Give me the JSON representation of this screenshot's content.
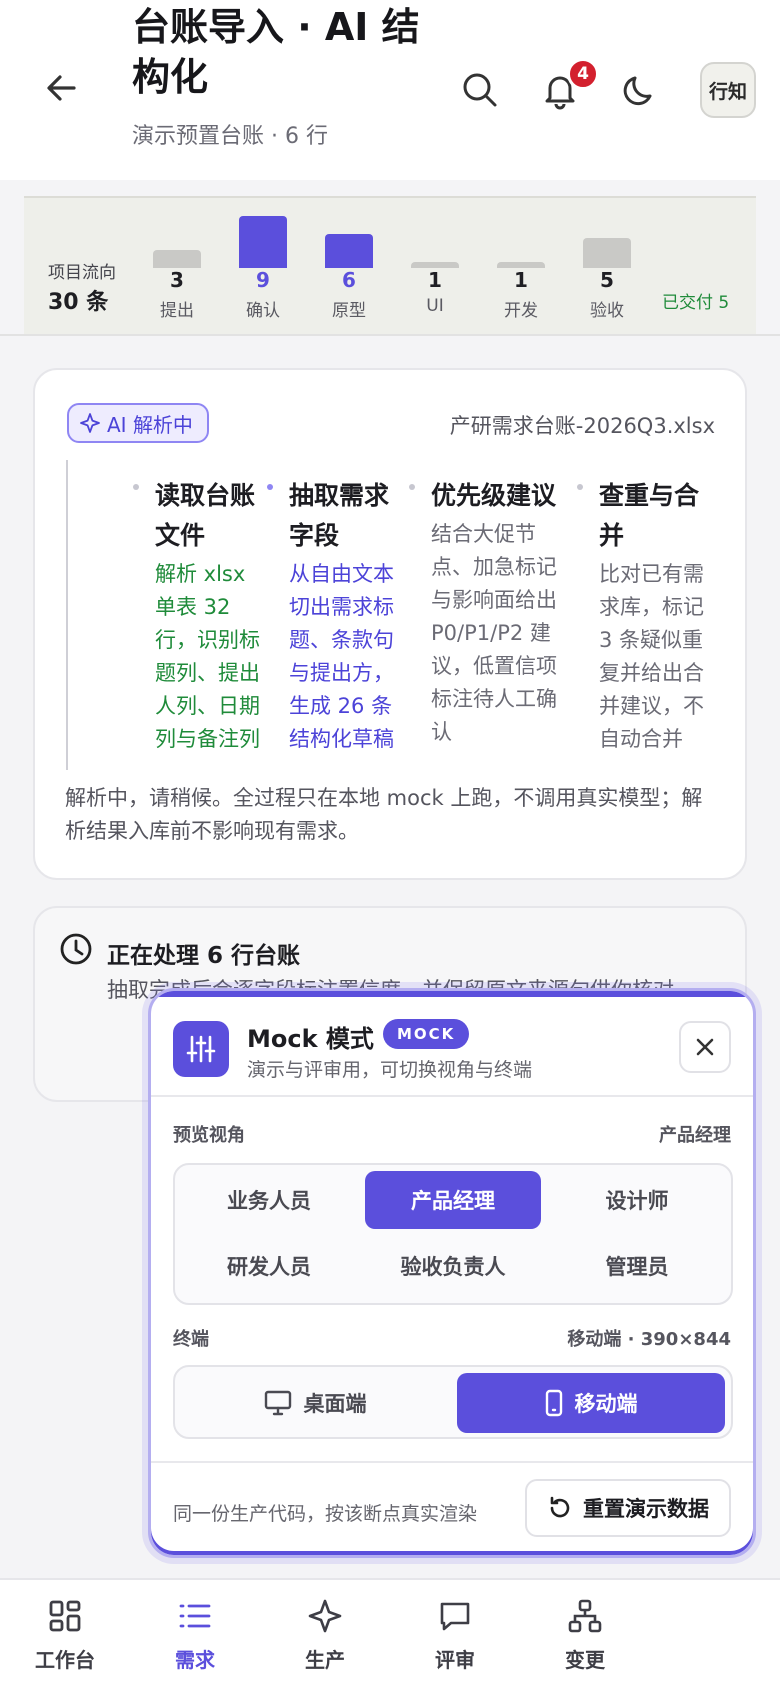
{
  "header": {
    "title": "台账导入 · AI 结构化",
    "subtitle": "演示预置台账 · 6 行",
    "notification_count": "4",
    "avatar_text": "行知",
    "icons": [
      "back-arrow-icon",
      "search-icon",
      "bell-icon",
      "moon-icon"
    ]
  },
  "flow": {
    "label": "项目流向",
    "count": "30 条",
    "stages": [
      {
        "label": "提出",
        "count": "3",
        "highlight": false
      },
      {
        "label": "确认",
        "count": "9",
        "highlight": true
      },
      {
        "label": "原型",
        "count": "6",
        "highlight": true
      },
      {
        "label": "UI",
        "count": "1",
        "highlight": false
      },
      {
        "label": "开发",
        "count": "1",
        "highlight": false
      },
      {
        "label": "验收",
        "count": "5",
        "highlight": false
      }
    ],
    "delivered": "已交付 5"
  },
  "parse_card": {
    "chip": "AI 解析中",
    "filename": "产研需求台账-2026Q3.xlsx",
    "steps": [
      {
        "title": "读取台账文件",
        "desc": "解析 xlsx 单表 32 行，识别标题列、提出人列、日期列与备注列",
        "state": "done"
      },
      {
        "title": "抽取需求字段",
        "desc": "从自由文本切出需求标题、条款句与提出方，生成 26 条结构化草稿",
        "state": "active"
      },
      {
        "title": "优先级建议",
        "desc": "结合大促节点、加急标记与影响面给出 P0/P1/P2 建议，低置信项标注待人工确认",
        "state": "pending"
      },
      {
        "title": "查重与合并",
        "desc": "比对已有需求库，标记 3 条疑似重复并给出合并建议，不自动合并",
        "state": "pending"
      }
    ],
    "note": "解析中，请稍候。全过程只在本地 mock 上跑，不调用真实模型；解析结果入库前不影响现有需求。"
  },
  "processing_card": {
    "title": "正在处理 6 行台账",
    "body": "抽取完成后会逐字段标注置信度，并保留原文来源句供你核对"
  },
  "mock_panel": {
    "title": "Mock 模式",
    "tag": "MOCK",
    "subtitle": "演示与评审用，可切换视角与终端",
    "view_label": "预览视角",
    "view_value": "产品经理",
    "roles": [
      "业务人员",
      "产品经理",
      "设计师",
      "研发人员",
      "验收负责人",
      "管理员"
    ],
    "active_role": "产品经理",
    "terminal_label": "终端",
    "terminal_value": "移动端 · 390×844",
    "terminals": [
      "桌面端",
      "移动端"
    ],
    "active_terminal": "移动端",
    "footer_text": "同一份生产代码，按该断点真实渲染",
    "reset_label": "重置演示数据"
  },
  "bottom_nav": [
    {
      "label": "工作台",
      "icon": "grid-icon",
      "active": false
    },
    {
      "label": "需求",
      "icon": "list-icon",
      "active": true
    },
    {
      "label": "生产",
      "icon": "sparkle-icon",
      "active": false
    },
    {
      "label": "评审",
      "icon": "chat-icon",
      "active": false
    },
    {
      "label": "变更",
      "icon": "hierarchy-icon",
      "active": false
    }
  ],
  "colors": {
    "accent": "#5b4fdc",
    "done_text": "#1f8b3a",
    "active_text": "#4c43d8",
    "badge": "#d3202e"
  }
}
